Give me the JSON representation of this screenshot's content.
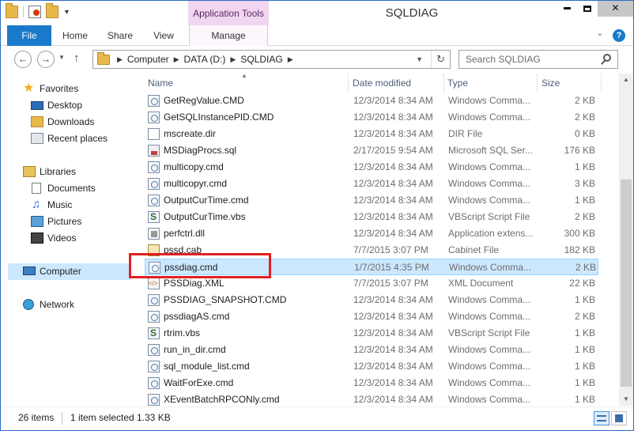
{
  "window": {
    "title": "SQLDIAG",
    "contextual_group": "Application Tools",
    "buttons": {
      "minimize": "—",
      "maximize": "□",
      "close": "✕"
    }
  },
  "ribbon": {
    "tabs": [
      {
        "label": "File",
        "active": true
      },
      {
        "label": "Home"
      },
      {
        "label": "Share"
      },
      {
        "label": "View"
      },
      {
        "label": "Manage"
      }
    ],
    "help": "?"
  },
  "address": {
    "crumbs": [
      "Computer",
      "DATA (D:)",
      "SQLDIAG"
    ]
  },
  "search": {
    "placeholder": "Search SQLDIAG"
  },
  "nav": {
    "items": [
      {
        "label": "Favorites",
        "icon": "star-icon"
      },
      {
        "label": "Desktop",
        "icon": "desktop-icon"
      },
      {
        "label": "Downloads",
        "icon": "downloads-icon"
      },
      {
        "label": "Recent places",
        "icon": "recent-places-icon"
      },
      {
        "label": "Libraries",
        "icon": "libraries-icon"
      },
      {
        "label": "Documents",
        "icon": "documents-icon"
      },
      {
        "label": "Music",
        "icon": "music-icon"
      },
      {
        "label": "Pictures",
        "icon": "pictures-icon"
      },
      {
        "label": "Videos",
        "icon": "videos-icon"
      },
      {
        "label": "Computer",
        "icon": "computer-icon",
        "selected": true
      },
      {
        "label": "Network",
        "icon": "network-icon"
      }
    ]
  },
  "columns": {
    "name": "Name",
    "date": "Date modified",
    "type": "Type",
    "size": "Size"
  },
  "files": [
    {
      "name": "GetRegValue.CMD",
      "date": "12/3/2014 8:34 AM",
      "type": "Windows Comma...",
      "size": "2 KB",
      "kind": "cmd"
    },
    {
      "name": "GetSQLInstancePID.CMD",
      "date": "12/3/2014 8:34 AM",
      "type": "Windows Comma...",
      "size": "2 KB",
      "kind": "cmd"
    },
    {
      "name": "mscreate.dir",
      "date": "12/3/2014 8:34 AM",
      "type": "DIR File",
      "size": "0 KB",
      "kind": "dir"
    },
    {
      "name": "MSDiagProcs.sql",
      "date": "2/17/2015 9:54 AM",
      "type": "Microsoft SQL Ser...",
      "size": "176 KB",
      "kind": "sql"
    },
    {
      "name": "multicopy.cmd",
      "date": "12/3/2014 8:34 AM",
      "type": "Windows Comma...",
      "size": "1 KB",
      "kind": "cmd"
    },
    {
      "name": "multicopyr.cmd",
      "date": "12/3/2014 8:34 AM",
      "type": "Windows Comma...",
      "size": "3 KB",
      "kind": "cmd"
    },
    {
      "name": "OutputCurTime.cmd",
      "date": "12/3/2014 8:34 AM",
      "type": "Windows Comma...",
      "size": "1 KB",
      "kind": "cmd"
    },
    {
      "name": "OutputCurTime.vbs",
      "date": "12/3/2014 8:34 AM",
      "type": "VBScript Script File",
      "size": "2 KB",
      "kind": "vbs"
    },
    {
      "name": "perfctrl.dll",
      "date": "12/3/2014 8:34 AM",
      "type": "Application extens...",
      "size": "300 KB",
      "kind": "dll"
    },
    {
      "name": "pssd.cab",
      "date": "7/7/2015 3:07 PM",
      "type": "Cabinet File",
      "size": "182 KB",
      "kind": "cab"
    },
    {
      "name": "pssdiag.cmd",
      "date": "1/7/2015 4:35 PM",
      "type": "Windows Comma...",
      "size": "2 KB",
      "kind": "cmd",
      "selected": true
    },
    {
      "name": "PSSDiag.XML",
      "date": "7/7/2015 3:07 PM",
      "type": "XML Document",
      "size": "22 KB",
      "kind": "xml"
    },
    {
      "name": "PSSDIAG_SNAPSHOT.CMD",
      "date": "12/3/2014 8:34 AM",
      "type": "Windows Comma...",
      "size": "1 KB",
      "kind": "cmd"
    },
    {
      "name": "pssdiagAS.cmd",
      "date": "12/3/2014 8:34 AM",
      "type": "Windows Comma...",
      "size": "2 KB",
      "kind": "cmd"
    },
    {
      "name": "rtrim.vbs",
      "date": "12/3/2014 8:34 AM",
      "type": "VBScript Script File",
      "size": "1 KB",
      "kind": "vbs"
    },
    {
      "name": "run_in_dir.cmd",
      "date": "12/3/2014 8:34 AM",
      "type": "Windows Comma...",
      "size": "1 KB",
      "kind": "cmd"
    },
    {
      "name": "sql_module_list.cmd",
      "date": "12/3/2014 8:34 AM",
      "type": "Windows Comma...",
      "size": "1 KB",
      "kind": "cmd"
    },
    {
      "name": "WaitForExe.cmd",
      "date": "12/3/2014 8:34 AM",
      "type": "Windows Comma...",
      "size": "1 KB",
      "kind": "cmd"
    },
    {
      "name": "XEventBatchRPCONly.cmd",
      "date": "12/3/2014 8:34 AM",
      "type": "Windows Comma...",
      "size": "1 KB",
      "kind": "cmd"
    }
  ],
  "status": {
    "count": "26 items",
    "selection": "1 item selected",
    "selection_size": "1.33 KB"
  },
  "colors": {
    "accent": "#1979ca",
    "selection": "#cce8ff",
    "highlight_box": "#e02020",
    "contextual_tab": "#f0d6f0"
  }
}
